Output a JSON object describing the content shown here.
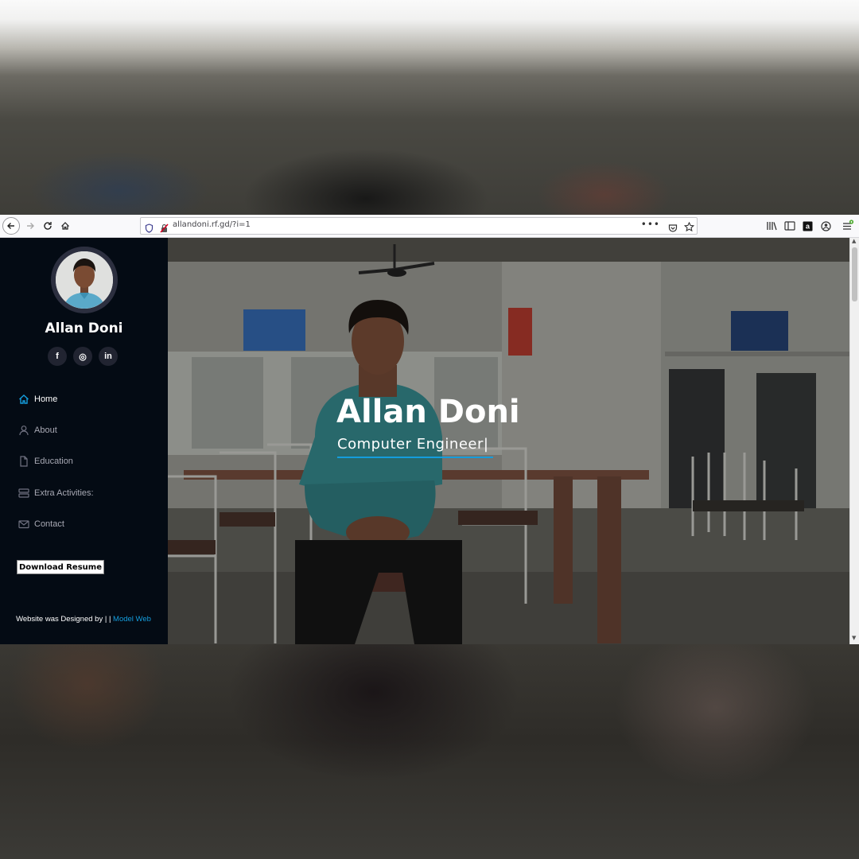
{
  "browser": {
    "url": "allandoni.rf.gd/?i=1",
    "more_label": "•••",
    "icons": [
      "back-arrow-icon",
      "forward-arrow-icon",
      "reload-icon",
      "home-icon",
      "shield-icon",
      "insecure-lock-icon",
      "pocket-icon",
      "bookmark-star-icon",
      "library-icon",
      "sidebar-icon",
      "amazon-icon",
      "account-icon",
      "menu-icon"
    ]
  },
  "sidebar": {
    "name": "Allan Doni",
    "socials": [
      {
        "icon": "facebook-icon",
        "label": "f"
      },
      {
        "icon": "instagram-icon",
        "label": "◎"
      },
      {
        "icon": "linkedin-icon",
        "label": "in"
      }
    ],
    "nav": [
      {
        "label": "Home",
        "icon": "home-icon",
        "active": true
      },
      {
        "label": "About",
        "icon": "user-icon",
        "active": false
      },
      {
        "label": "Education",
        "icon": "file-icon",
        "active": false
      },
      {
        "label": "Extra Activities:",
        "icon": "server-icon",
        "active": false
      },
      {
        "label": "Contact",
        "icon": "envelope-icon",
        "active": false
      }
    ],
    "download_label": "Download Resume",
    "credit_text": "Website was Designed by | |",
    "credit_link": "Model Web"
  },
  "hero": {
    "title": "Allan Doni",
    "subtitle": "Computer Engineer|"
  },
  "colors": {
    "sidebar_bg": "#040b14",
    "accent": "#149ddd",
    "social_bg": "#212431"
  }
}
